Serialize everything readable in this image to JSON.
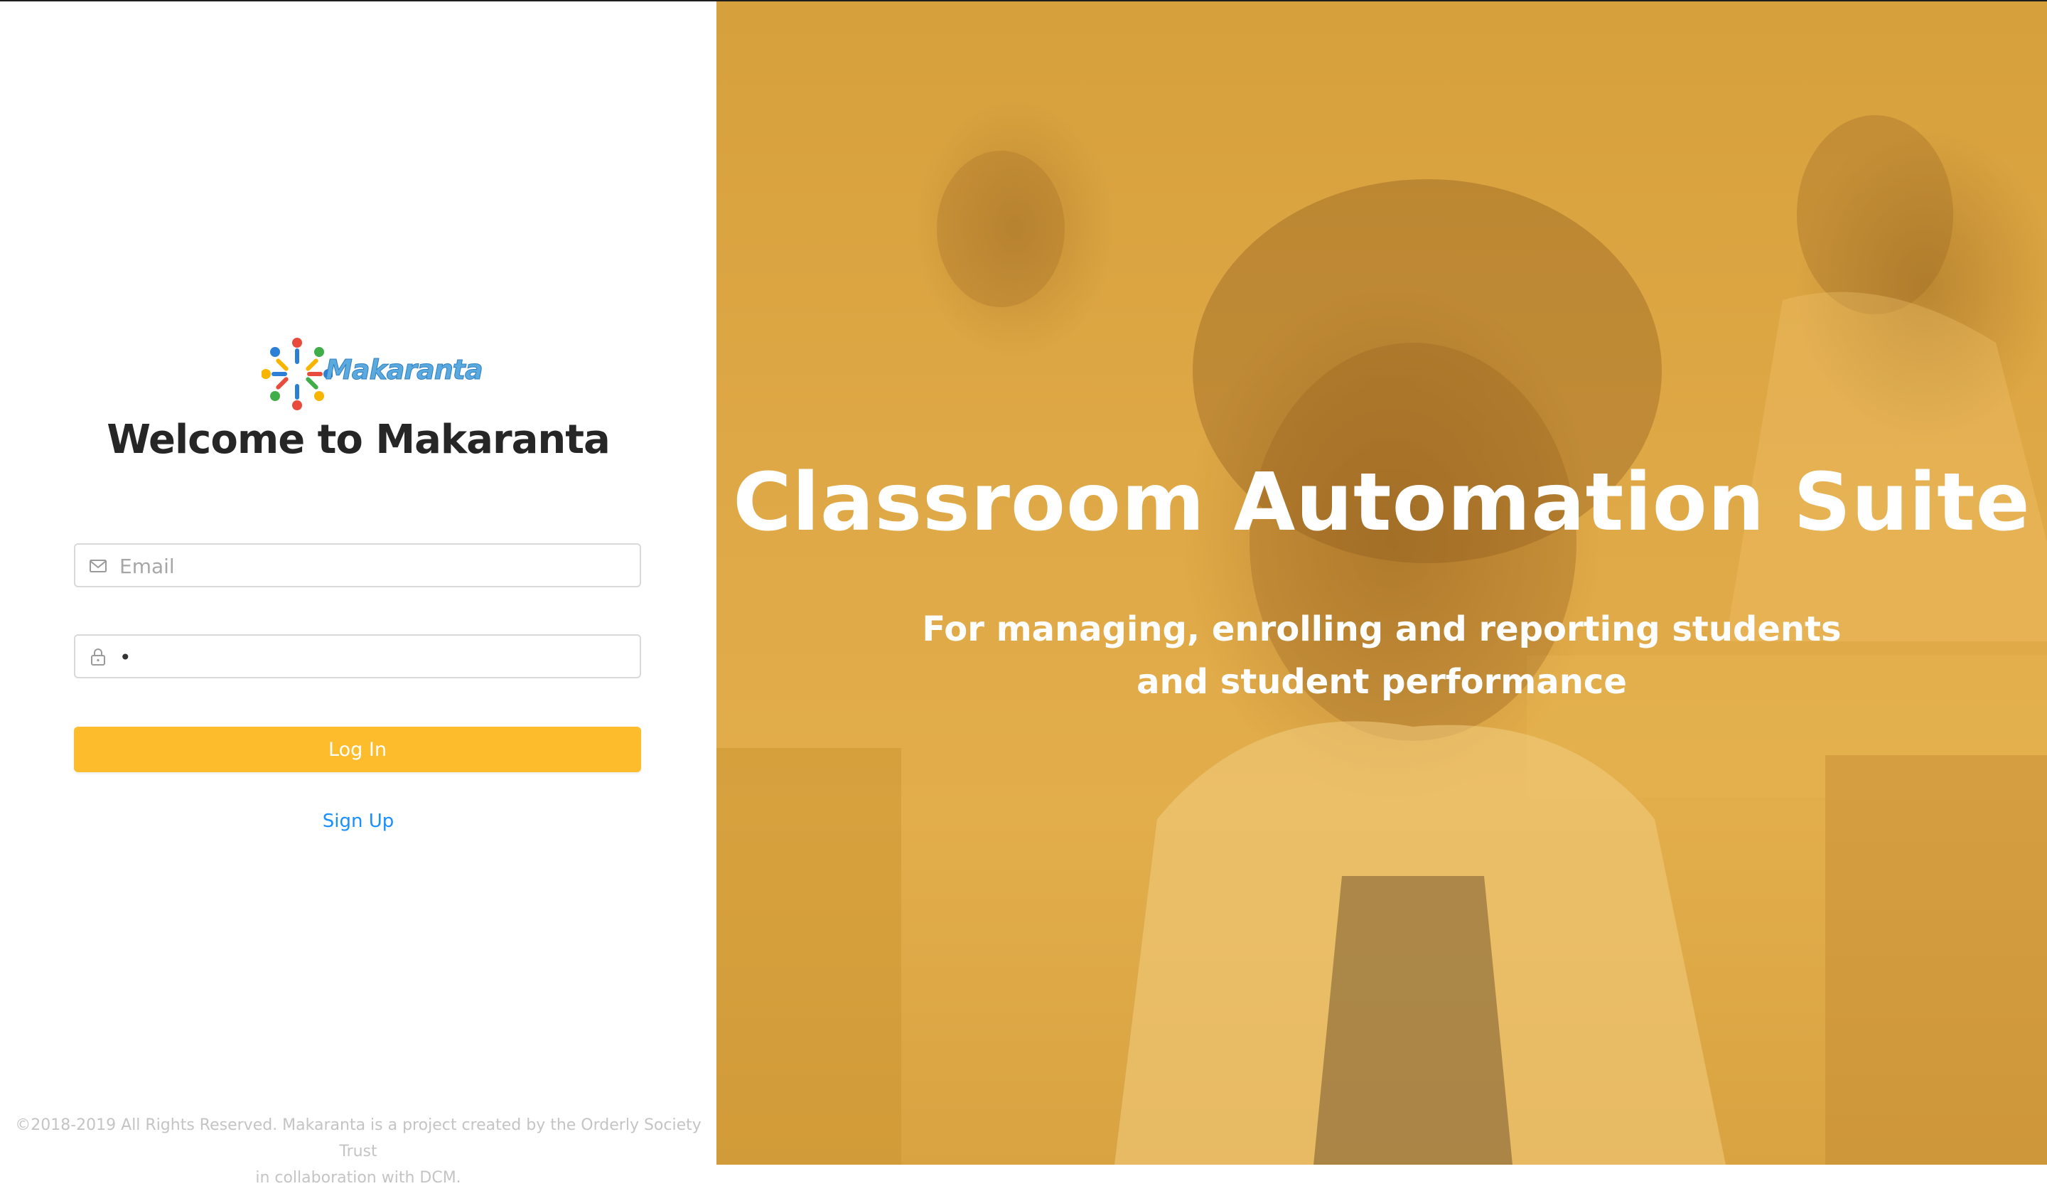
{
  "brand": {
    "logo_text": "Makaranta",
    "welcome": "Welcome to Makaranta"
  },
  "form": {
    "email_placeholder": "Email",
    "password_value": "•",
    "login_label": "Log In",
    "signup_label": "Sign Up"
  },
  "footer": {
    "line1": "©2018-2019 All Rights Reserved. Makaranta is a project created by the Orderly Society Trust",
    "line2": "in collaboration with DCM."
  },
  "hero": {
    "title": "Classroom Automation Suite",
    "subtitle_line1": "For managing, enrolling and reporting students",
    "subtitle_line2": "and student performance"
  },
  "colors": {
    "accent": "#fdbc2c",
    "link": "#1890ff",
    "overlay": "#dfa846"
  },
  "icons": {
    "email": "mail-icon",
    "password": "lock-icon"
  }
}
